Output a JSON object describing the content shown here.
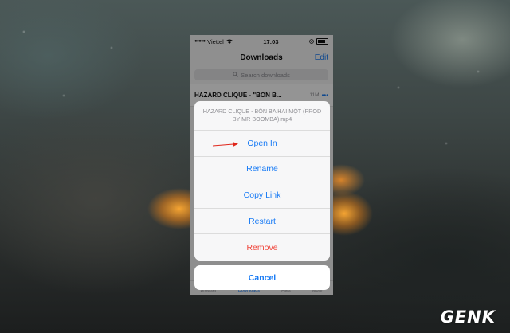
{
  "status": {
    "carrier": "Viettel",
    "time": "17:03"
  },
  "nav": {
    "title": "Downloads",
    "edit_label": "Edit"
  },
  "search": {
    "placeholder": "Search downloads"
  },
  "download_item": {
    "title": "HAZARD CLIQUE - \"BỐN B...",
    "size": "11M"
  },
  "tabbar": {
    "items": [
      "Browser",
      "Downloads",
      "Files",
      "More"
    ]
  },
  "action_sheet": {
    "header": "HAZARD CLIQUE - BỐN BA HAI MỘT (PROD BY MR BOOMBA).mp4",
    "options": [
      "Open In",
      "Rename",
      "Copy Link",
      "Restart",
      "Remove"
    ],
    "cancel_label": "Cancel"
  },
  "watermark": {
    "text": "GENK"
  },
  "colors": {
    "accent": "#1a7cf5",
    "destructive": "#f0443a",
    "annotation_arrow": "#e0261b"
  },
  "icons": {
    "wifi": "wifi-icon",
    "battery": "battery-icon",
    "search": "search-icon",
    "more": "ellipsis-icon",
    "annotation": "red-arrow-icon"
  }
}
